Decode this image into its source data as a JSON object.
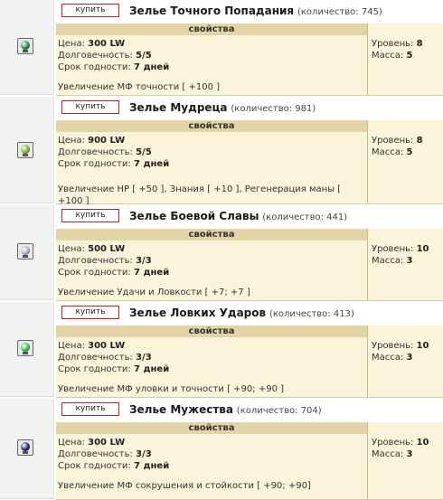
{
  "buy_label": "купить",
  "props_header": "свойства",
  "labels": {
    "price": "Цена:",
    "durability": "Долговечность:",
    "expiry": "Срок годности:",
    "level": "Уровень:",
    "mass": "Масса:"
  },
  "items": [
    {
      "name": "Зелье Точного Попадания",
      "qty": "(количество: 745)",
      "price": "300 LW",
      "durability": "5/5",
      "expiry": "7 дней",
      "effects": "Увеличение МФ точности [ +100 ]",
      "level": "8",
      "mass": "5",
      "icon": "green-potion-icon",
      "color": "#1e8a3a"
    },
    {
      "name": "Зелье Мудреца",
      "qty": "(количество: 981)",
      "price": "900 LW",
      "durability": "5/5",
      "expiry": "7 дней",
      "effects": "Увеличение HP [ +50 ], Знания [ +10 ], Регенерация маны [ +100 ]",
      "level": "8",
      "mass": "5",
      "icon": "leaf-potion-icon",
      "color": "#7fb03a"
    },
    {
      "name": "Зелье Боевой Славы",
      "qty": "(количество: 441)",
      "price": "500 LW",
      "durability": "3/3",
      "expiry": "7 дней",
      "effects": "Увеличение Удачи и Ловкости [ +7; +7 ]",
      "level": "10",
      "mass": "3",
      "icon": "gray-potion-icon",
      "color": "#a8b0c0"
    },
    {
      "name": "Зелье Ловких Ударов",
      "qty": "(количество: 413)",
      "price": "300 LW",
      "durability": "3/3",
      "expiry": "7 дней",
      "effects": "Увеличение МФ уловки и точности [ +90; +90 ]",
      "level": "10",
      "mass": "3",
      "icon": "bright-green-potion-icon",
      "color": "#2fc24a"
    },
    {
      "name": "Зелье Мужества",
      "qty": "(количество: 704)",
      "price": "300 LW",
      "durability": "3/3",
      "expiry": "7 дней",
      "effects": "Увеличение МФ сокрушения и стойкости [ +90; +90]",
      "level": "10",
      "mass": "3",
      "icon": "dark-blue-potion-icon",
      "color": "#1d2a6e"
    }
  ]
}
